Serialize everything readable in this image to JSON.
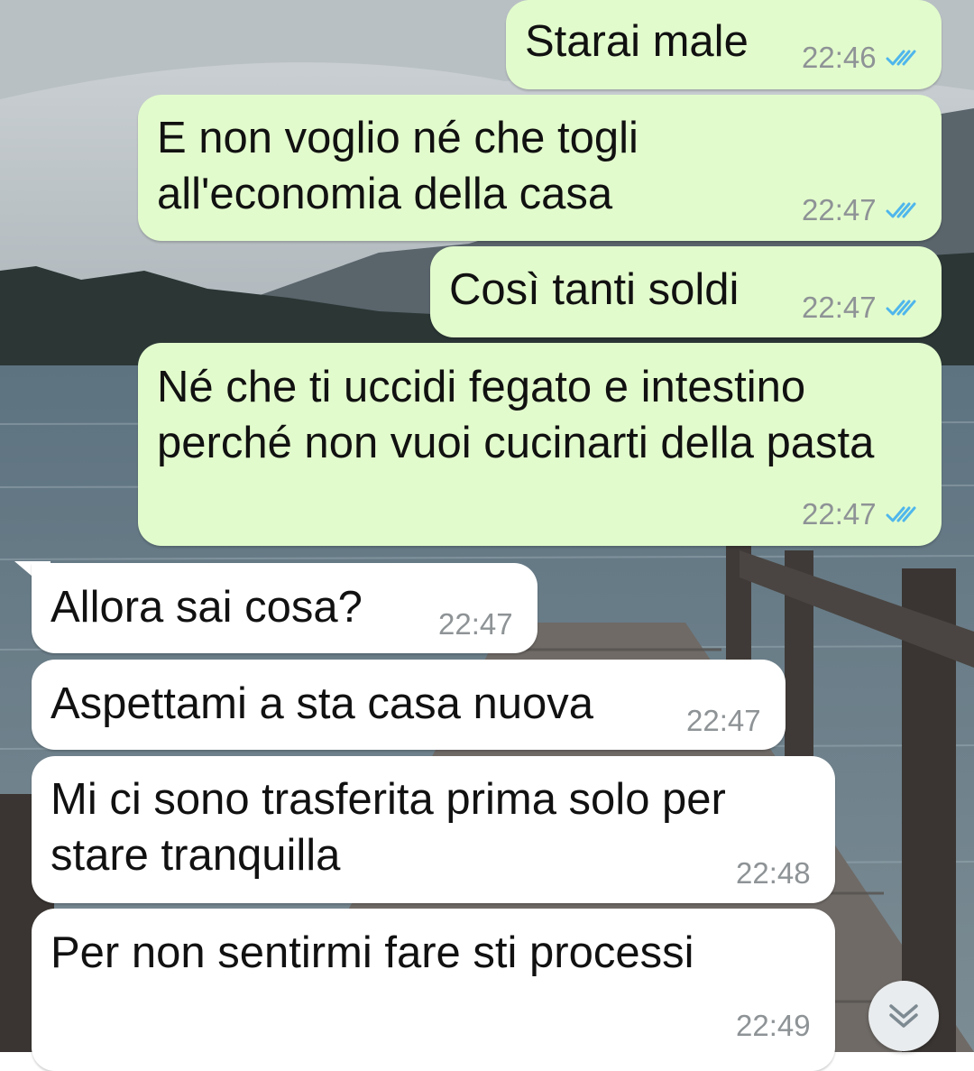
{
  "chat": {
    "messages": [
      {
        "direction": "out",
        "text": "Starai male",
        "time": "22:46",
        "status": "read"
      },
      {
        "direction": "out",
        "text": "E non voglio né che togli\nall'economia della casa",
        "time": "22:47",
        "status": "read"
      },
      {
        "direction": "out",
        "text": "Così tanti soldi",
        "time": "22:47",
        "status": "read"
      },
      {
        "direction": "out",
        "text": "Né che ti uccidi fegato e intestino\nperché non vuoi cucinarti della pasta",
        "time": "22:47",
        "status": "read"
      },
      {
        "direction": "in",
        "text": "Allora sai cosa?",
        "time": "22:47"
      },
      {
        "direction": "in",
        "text": "Aspettami a sta casa nuova",
        "time": "22:47"
      },
      {
        "direction": "in",
        "text": "Mi ci sono trasferita prima solo per\nstare tranquilla",
        "time": "22:48"
      },
      {
        "direction": "in",
        "text": "Per non sentirmi fare sti processi",
        "time": "22:49"
      }
    ]
  },
  "colors": {
    "outgoing_bubble": "#e2fbcc",
    "incoming_bubble": "#ffffff",
    "read_ticks": "#4fb6ec",
    "timestamp": "#8e9396"
  },
  "icons": {
    "read_receipt": "double-check-icon",
    "scroll_down": "double-chevron-down-icon"
  }
}
